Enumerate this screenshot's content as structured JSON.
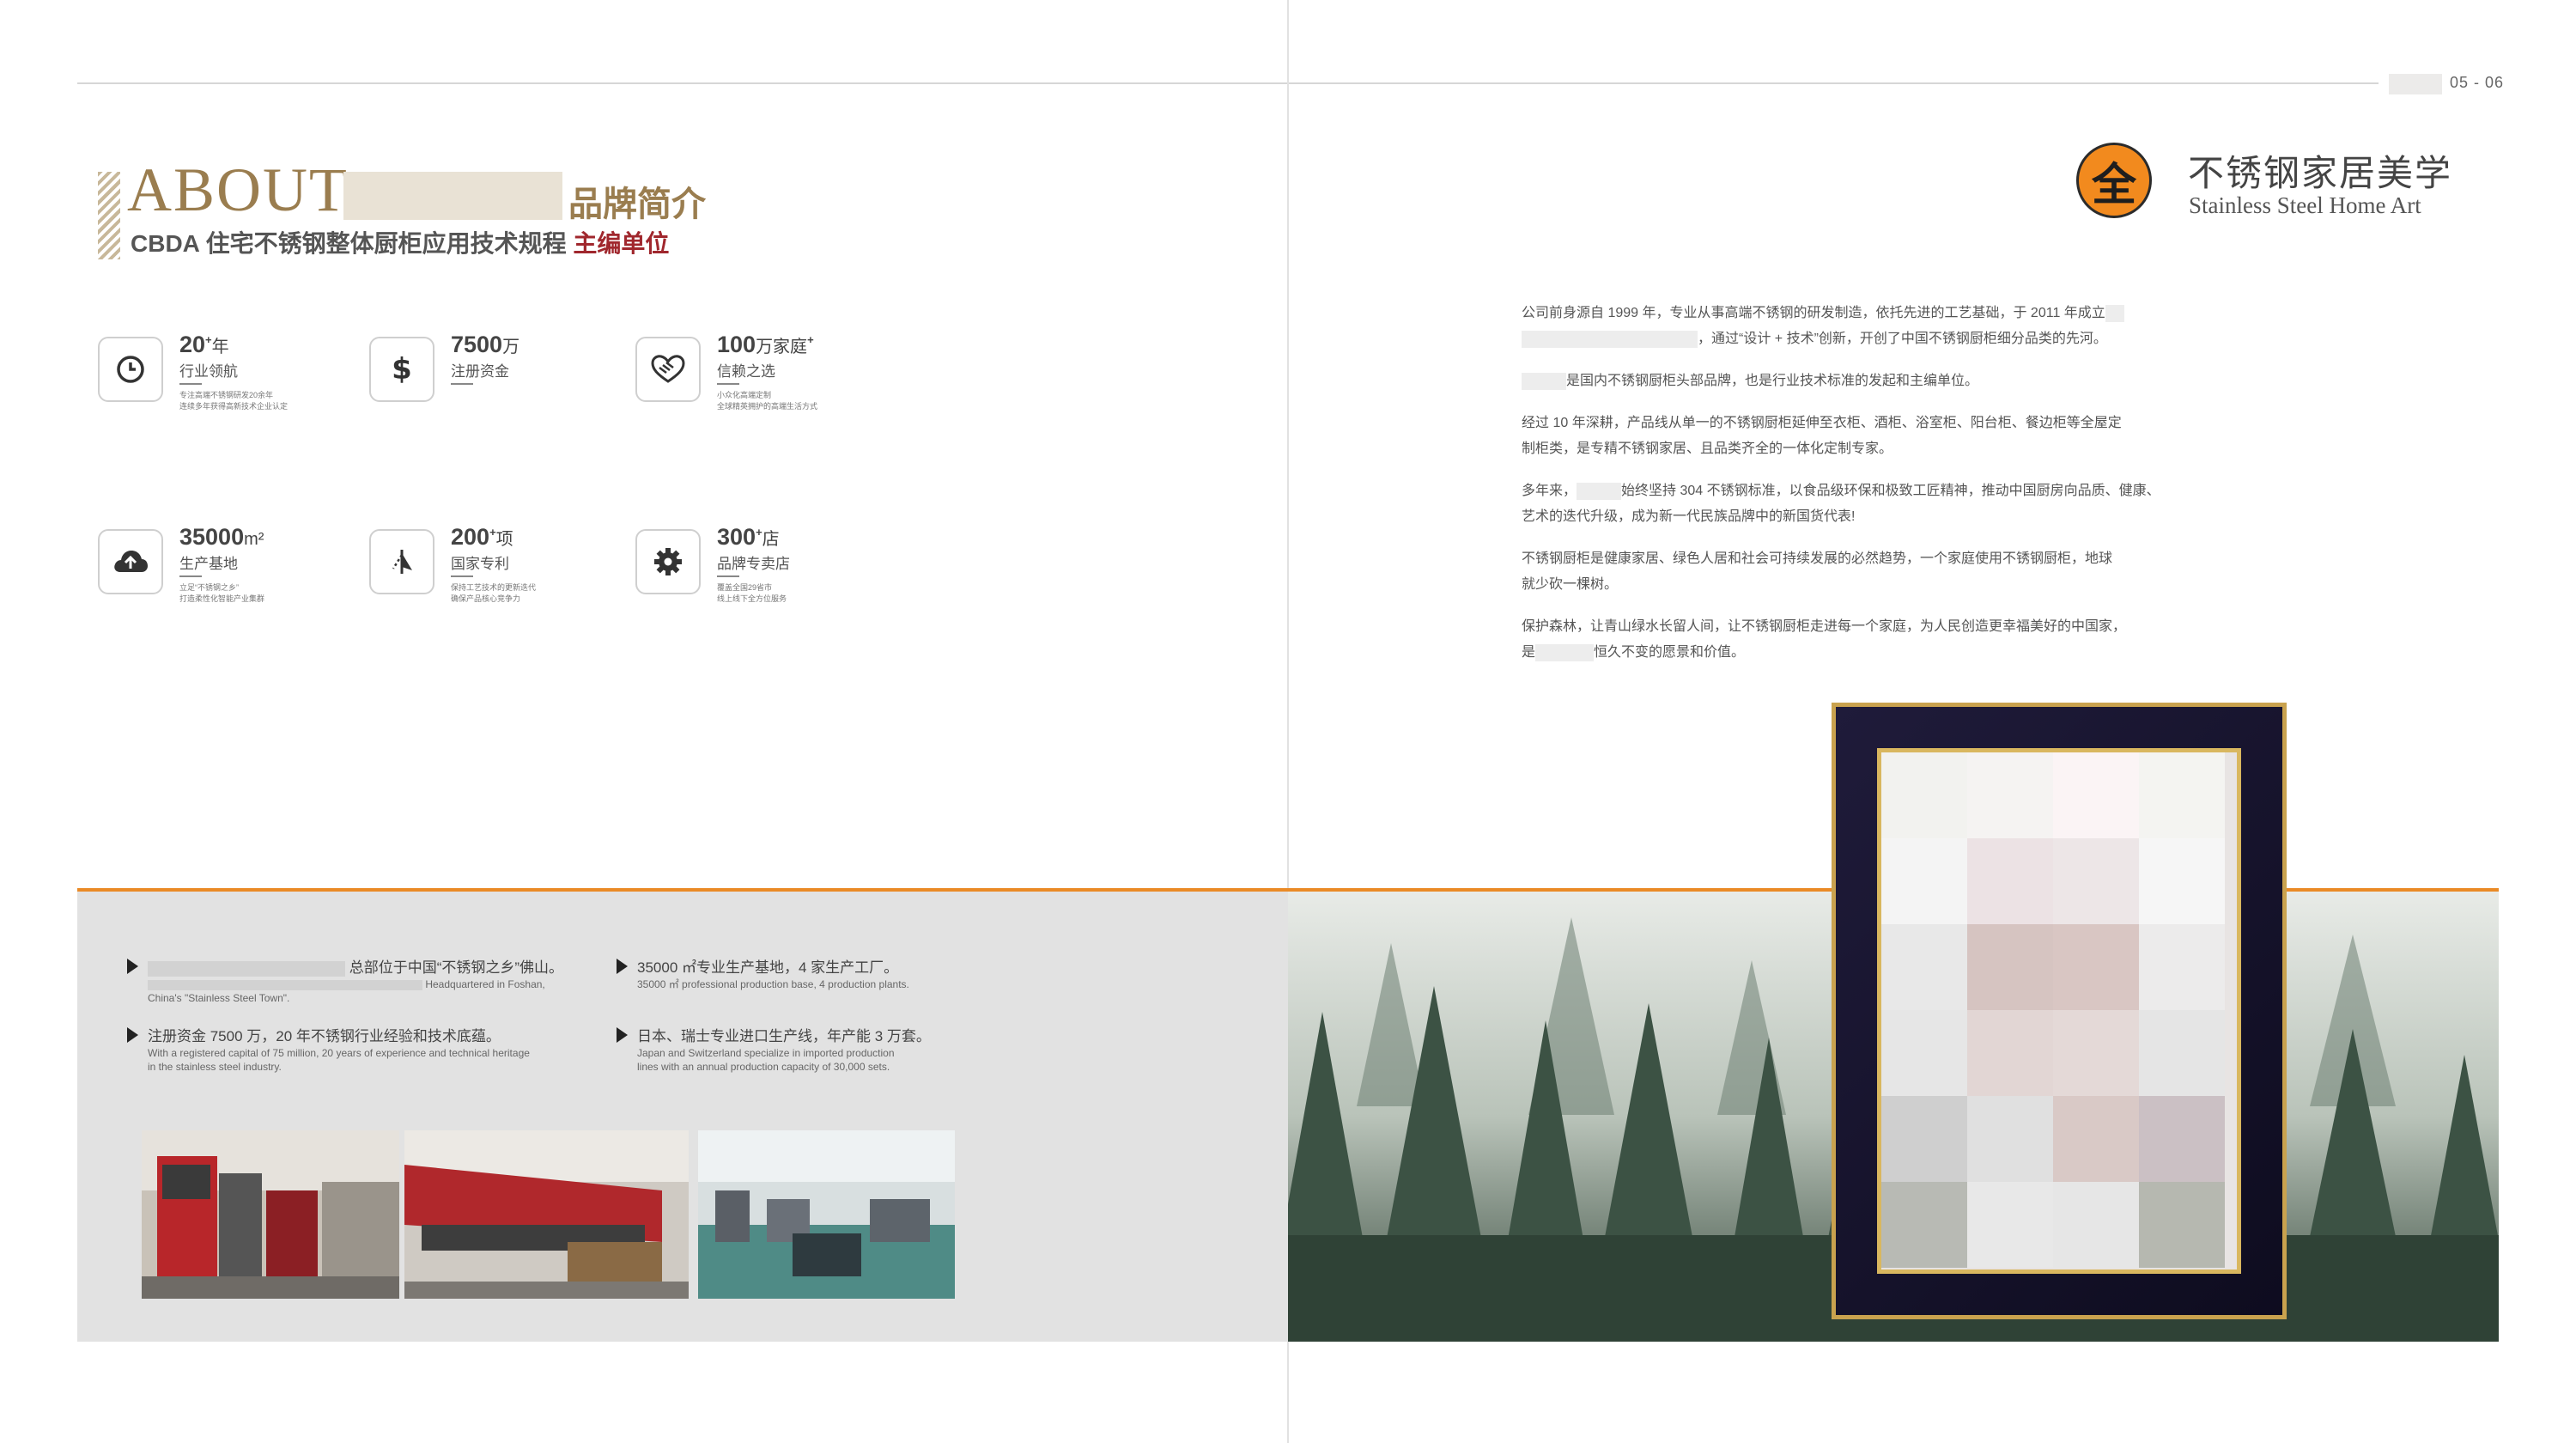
{
  "page_number": "05 - 06",
  "left": {
    "about_title": "ABOUT",
    "brand_intro": "品牌简介",
    "sub_heading_main": "CBDA 住宅不锈钢整体厨柜应用技术规程 ",
    "sub_heading_highlight": "主编单位",
    "stats": [
      {
        "icon": "clock-icon",
        "num": "20",
        "unit": "年",
        "sup": "+",
        "label": "行业领航",
        "desc1": "专注高端不锈钢研发20余年",
        "desc2": "连续多年获得高新技术企业认定"
      },
      {
        "icon": "dollar-icon",
        "num": "7500",
        "unit": "万",
        "sup": "",
        "label": "注册资金",
        "desc1": "",
        "desc2": ""
      },
      {
        "icon": "handshake-icon",
        "num": "100",
        "unit": "万家庭",
        "sup": "+",
        "label": "信赖之选",
        "desc1": "小众化高端定制",
        "desc2": "全球精英拥护的高端生活方式"
      },
      {
        "icon": "cloud-upload-icon",
        "num": "35000",
        "unit": "m²",
        "sup": "",
        "label": "生产基地",
        "desc1": "立足“不锈钢之乡”",
        "desc2": "打造柔性化智能产业集群"
      },
      {
        "icon": "patent-icon",
        "num": "200",
        "unit": "项",
        "sup": "+",
        "label": "国家专利",
        "desc1": "保持工艺技术的更新迭代",
        "desc2": "确保产品核心竞争力"
      },
      {
        "icon": "gear-icon",
        "num": "300",
        "unit": "店",
        "sup": "+",
        "label": "品牌专卖店",
        "desc1": "覆盖全国29省市",
        "desc2": "线上线下全方位服务"
      }
    ],
    "bullets": [
      {
        "cn": "总部位于中国“不锈钢之乡”佛山。",
        "en1": "Headquartered in Foshan,",
        "en2": "China's \"Stainless Steel Town\"."
      },
      {
        "cn": "35000 ㎡专业生产基地，4 家生产工厂。",
        "en1": "35000 ㎡ professional production base, 4 production plants.",
        "en2": ""
      },
      {
        "cn": "注册资金 7500 万，20 年不锈钢行业经验和技术底蕴。",
        "en1": "With a registered capital of 75 million, 20 years of experience and technical heritage",
        "en2": "in the stainless steel industry."
      },
      {
        "cn": "日本、瑞士专业进口生产线，年产能 3 万套。",
        "en1": "Japan and Switzerland specialize in imported production",
        "en2": "lines with an annual production capacity of 30,000 sets."
      }
    ]
  },
  "right": {
    "logo_char": "全",
    "logo_title": "不锈钢家居美学",
    "logo_subtitle": "Stainless Steel Home Art",
    "para1_a": "公司前身源自 1999 年，专业从事高端不锈钢的研发制造，依托先进的工艺基础，于 2011 年成立",
    "para1_b": "，通过“设计 + 技术”创新，开创了中国不锈钢厨柜细分品类的先河。",
    "para2": "是国内不锈钢厨柜头部品牌，也是行业技术标准的发起和主编单位。",
    "para3_a": "经过 10 年深耕，产品线从单一的不锈钢厨柜延伸至衣柜、酒柜、浴室柜、阳台柜、餐边柜等全屋定",
    "para3_b": "制柜类，是专精不锈钢家居、且品类齐全的一体化定制专家。",
    "para4_a": "多年来，",
    "para4_b": "始终坚持 304 不锈钢标准，以食品级环保和极致工匠精神，推动中国厨房向品质、健康、",
    "para4_c": "艺术的迭代升级，成为新一代民族品牌中的新国货代表!",
    "para5_a": "不锈钢厨柜是健康家居、绿色人居和社会可持续发展的必然趋势，一个家庭使用不锈钢厨柜，地球",
    "para5_b": "就少砍一棵树。",
    "para6_a": "保护森林，让青山绿水长留人间，让不锈钢厨柜走进每一个家庭，为人民创造更幸福美好的中国家，",
    "para6_b_pre": "是",
    "para6_b_post": "恒久不变的愿景和价值。"
  },
  "colors": {
    "accent_orange": "#ea8a26",
    "brand_gold": "#9a7d4f",
    "highlight_red": "#a0272d"
  }
}
